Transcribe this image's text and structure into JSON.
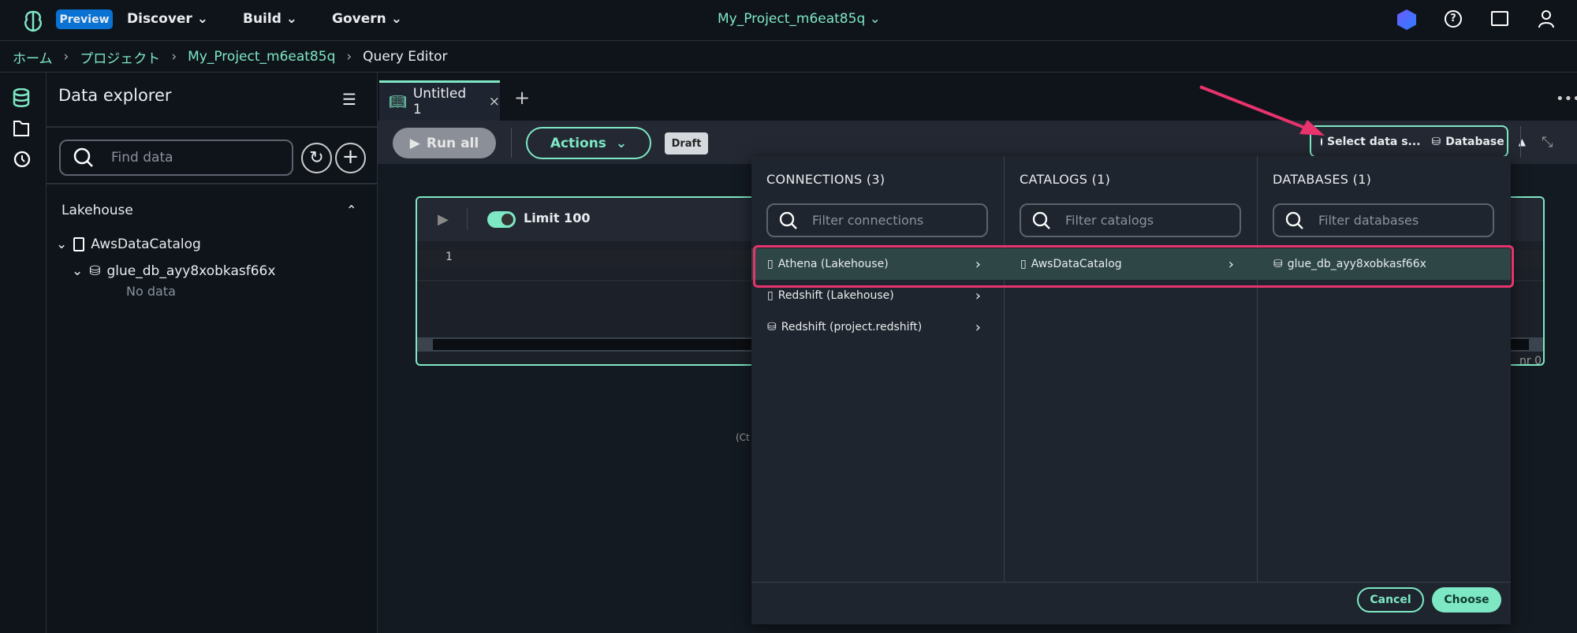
{
  "topbar": {
    "preview_badge": "Preview",
    "nav": [
      {
        "label": "Discover"
      },
      {
        "label": "Build"
      },
      {
        "label": "Govern"
      }
    ],
    "project": "My_Project_m6eat85q"
  },
  "breadcrumb": {
    "items": [
      "ホーム",
      "プロジェクト",
      "My_Project_m6eat85q"
    ],
    "current": "Query Editor"
  },
  "explorer": {
    "title": "Data explorer",
    "search_placeholder": "Find data",
    "section": "Lakehouse",
    "catalog": "AwsDataCatalog",
    "database": "glue_db_ayy8xobkasf66x",
    "empty": "No data"
  },
  "tabs": [
    {
      "label": "Untitled 1"
    }
  ],
  "toolbar": {
    "run_all": "Run all",
    "actions": "Actions",
    "draft": "Draft",
    "select_source": "Select data s...",
    "database": "Database"
  },
  "editor": {
    "limit": "Limit 100",
    "limit_on": true,
    "line_number": "1",
    "status_partial": "nr 0",
    "hint_partial": "(Ct"
  },
  "dropdown": {
    "connections": {
      "header": "CONNECTIONS (3)",
      "placeholder": "Filter connections",
      "items": [
        "Athena (Lakehouse)",
        "Redshift (Lakehouse)",
        "Redshift (project.redshift)"
      ]
    },
    "catalogs": {
      "header": "CATALOGS (1)",
      "placeholder": "Filter catalogs",
      "items": [
        "AwsDataCatalog"
      ]
    },
    "databases": {
      "header": "DATABASES (1)",
      "placeholder": "Filter databases",
      "items": [
        "glue_db_ayy8xobkasf66x"
      ]
    },
    "cancel": "Cancel",
    "choose": "Choose"
  },
  "colors": {
    "accent": "#7ee8c4",
    "highlight": "#e8336d",
    "badge": "#0972d3"
  }
}
